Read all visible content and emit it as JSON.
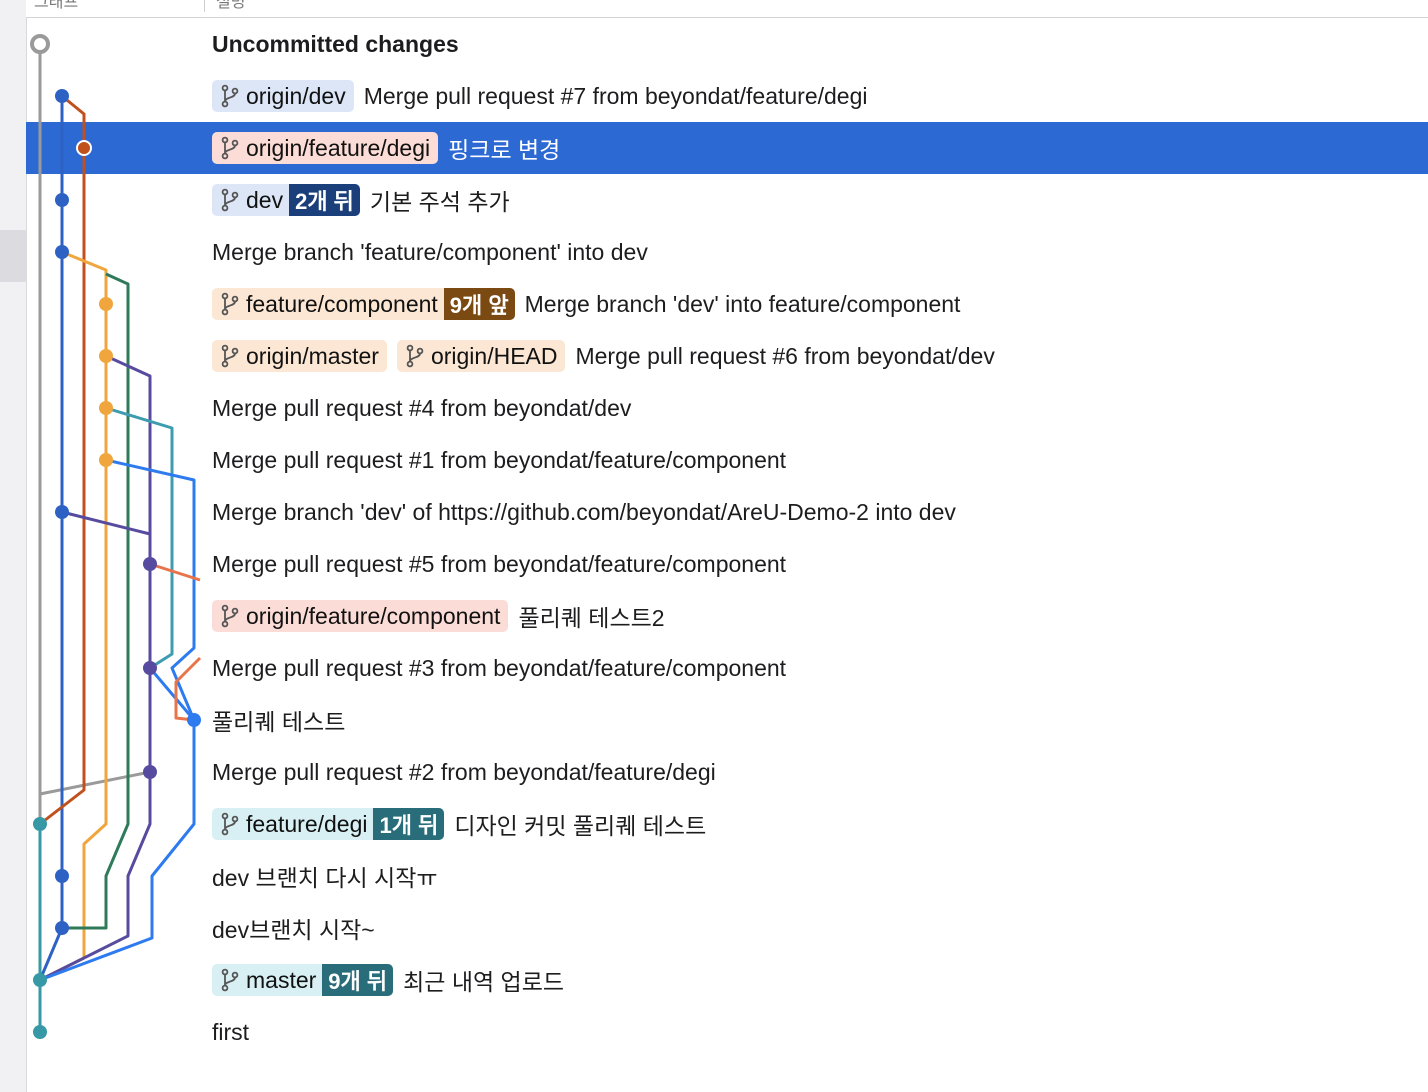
{
  "header": {
    "col1": "그래프",
    "col2": "설명"
  },
  "rows": [
    {
      "message": "Uncommitted changes",
      "refs": []
    },
    {
      "message": "Merge pull request #7 from beyondat/feature/degi",
      "refs": [
        {
          "name": "origin/dev",
          "bg": "#dce6f7"
        }
      ]
    },
    {
      "message": "핑크로 변경",
      "refs": [
        {
          "name": "origin/feature/degi",
          "bg": "#fbdcd6"
        }
      ]
    },
    {
      "message": "기본 주석 추가",
      "refs": [
        {
          "name": "dev",
          "bg": "#dce6f7",
          "badge": "2개 뒤",
          "badge_bg": "#1a3f7a"
        }
      ]
    },
    {
      "message": "Merge branch 'feature/component' into dev",
      "refs": []
    },
    {
      "message": "Merge branch 'dev' into feature/component",
      "refs": [
        {
          "name": "feature/component",
          "bg": "#fbe7d3",
          "badge": "9개 앞",
          "badge_bg": "#7a4a12"
        }
      ]
    },
    {
      "message": "Merge pull request #6 from beyondat/dev",
      "refs": [
        {
          "name": "origin/master",
          "bg": "#fbe7d3"
        },
        {
          "name": "origin/HEAD",
          "bg": "#fbe7d3"
        }
      ]
    },
    {
      "message": "Merge pull request #4 from beyondat/dev",
      "refs": []
    },
    {
      "message": "Merge pull request #1 from beyondat/feature/component",
      "refs": []
    },
    {
      "message": "Merge branch 'dev' of https://github.com/beyondat/AreU-Demo-2 into dev",
      "refs": []
    },
    {
      "message": "Merge pull request #5 from beyondat/feature/component",
      "refs": []
    },
    {
      "message": "풀리퀘 테스트2",
      "refs": [
        {
          "name": "origin/feature/component",
          "bg": "#fbdcd6"
        }
      ]
    },
    {
      "message": "Merge pull request #3 from beyondat/feature/component",
      "refs": []
    },
    {
      "message": "풀리퀘 테스트",
      "refs": []
    },
    {
      "message": "Merge pull request #2 from beyondat/feature/degi",
      "refs": []
    },
    {
      "message": "디자인 커밋 풀리퀘 테스트",
      "refs": [
        {
          "name": "feature/degi",
          "bg": "#d8f0f4",
          "badge": "1개 뒤",
          "badge_bg": "#2a6d7a"
        }
      ]
    },
    {
      "message": "dev 브랜치 다시 시작ㅠ",
      "refs": []
    },
    {
      "message": "dev브랜치 시작~",
      "refs": []
    },
    {
      "message": "최근 내역 업로드",
      "refs": [
        {
          "name": "master",
          "bg": "#d8f0f4",
          "badge": "9개 뒤",
          "badge_bg": "#2a6d7a"
        }
      ]
    },
    {
      "message": "first",
      "refs": []
    }
  ],
  "selected_row": 2,
  "bold_row": 0,
  "icons": {
    "branch": "git-branch-icon"
  },
  "graph_colors": {
    "gray": "#9a9a9a",
    "blue": "#2d62c4",
    "rust": "#c0501c",
    "orange": "#f0a63c",
    "green": "#2f7a5a",
    "purple": "#574ba0",
    "teal": "#3e9cb0",
    "bright_blue": "#2e7bf0",
    "salmon": "#e8744c",
    "node_teal": "#3798a6"
  }
}
